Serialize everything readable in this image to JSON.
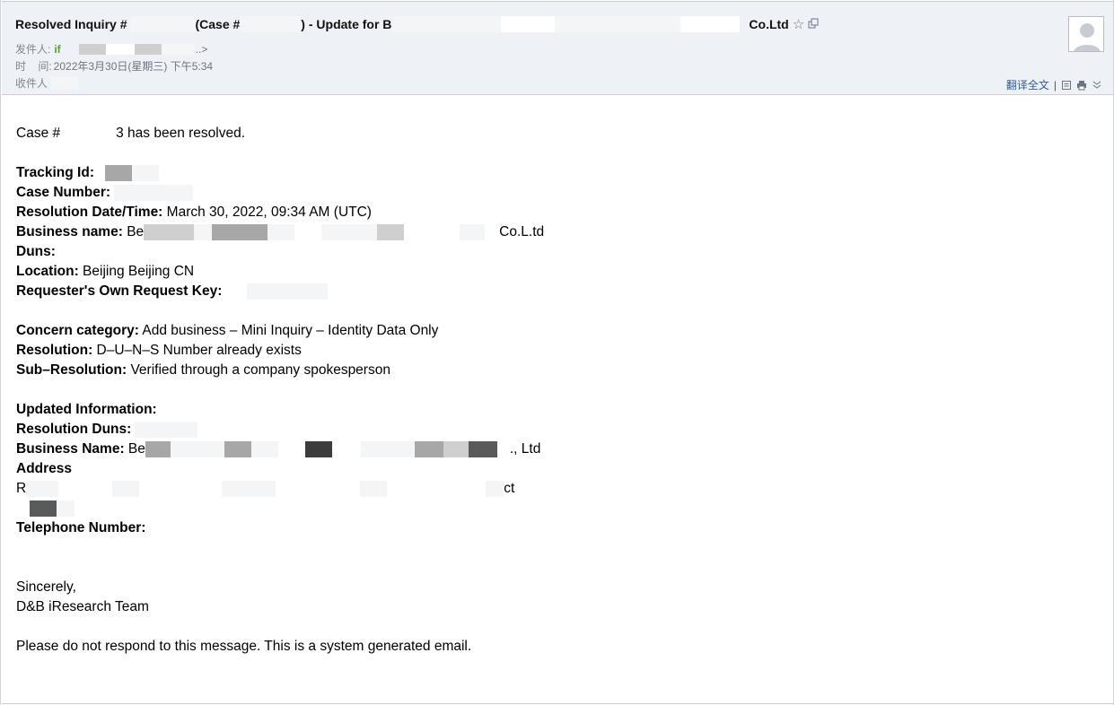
{
  "header": {
    "subject_prefix": "Resolved Inquiry #",
    "subject_case_open": "(Case #",
    "subject_case_close": ") - Update for B",
    "subject_suffix": "Co.Ltd",
    "sender_label": "发件人:",
    "sender_value_start": "if",
    "sender_value_end": "..>",
    "time_label": "时    间:",
    "time_value": "2022年3月30日(星期三) 下午5:34",
    "recipient_label": "收件人",
    "translate_label": "翻译全文",
    "divider": "|",
    "icons": [
      "star-icon",
      "popout-icon",
      "avatar-placeholder",
      "notes-icon",
      "print-icon",
      "more-chevron-icon"
    ]
  },
  "body": {
    "case_line_start": "Case #",
    "case_line_end": "3 has been resolved.",
    "tracking_label": "Tracking Id:",
    "tracking_value": "",
    "case_number_label": "Case Number:",
    "case_number_value": "",
    "resolution_datetime_label": "Resolution Date/Time:",
    "resolution_datetime_value": " March 30, 2022, 09:34 AM (UTC)",
    "business_name_label": "Business name:",
    "business_name_start": " Be",
    "business_name_end": "Co.L.td",
    "duns_label": "Duns:",
    "location_label": "Location:",
    "location_value": " Beijing Beijing CN",
    "requester_key_label": "Requester's Own Request Key:",
    "concern_label": "Concern category:",
    "concern_value": " Add business – Mini Inquiry – Identity Data Only",
    "resolution_label": "Resolution:",
    "resolution_value": " D–U–N–S Number already exists",
    "sub_resolution_label": "Sub–Resolution:",
    "sub_resolution_value": " Verified through a company spokesperson",
    "updated_info_label": "Updated Information:",
    "resolution_duns_label": "Resolution Duns:",
    "updated_business_name_label": "Business Name:",
    "updated_business_name_start": " Be",
    "updated_business_name_end": "., Ltd",
    "address_label": "Address",
    "address_start": "R",
    "address_end": "ct",
    "telephone_label": "Telephone Number:",
    "closing": "Sincerely,",
    "team": "D&B iResearch Team",
    "footer_note": "Please do not respond to this message. This is a system generated email."
  },
  "colors": {
    "header_bg": "#eef1f5",
    "link_blue": "#2f5e9e",
    "sender_green": "#5aa02c",
    "meta_grey": "#6e7480"
  }
}
